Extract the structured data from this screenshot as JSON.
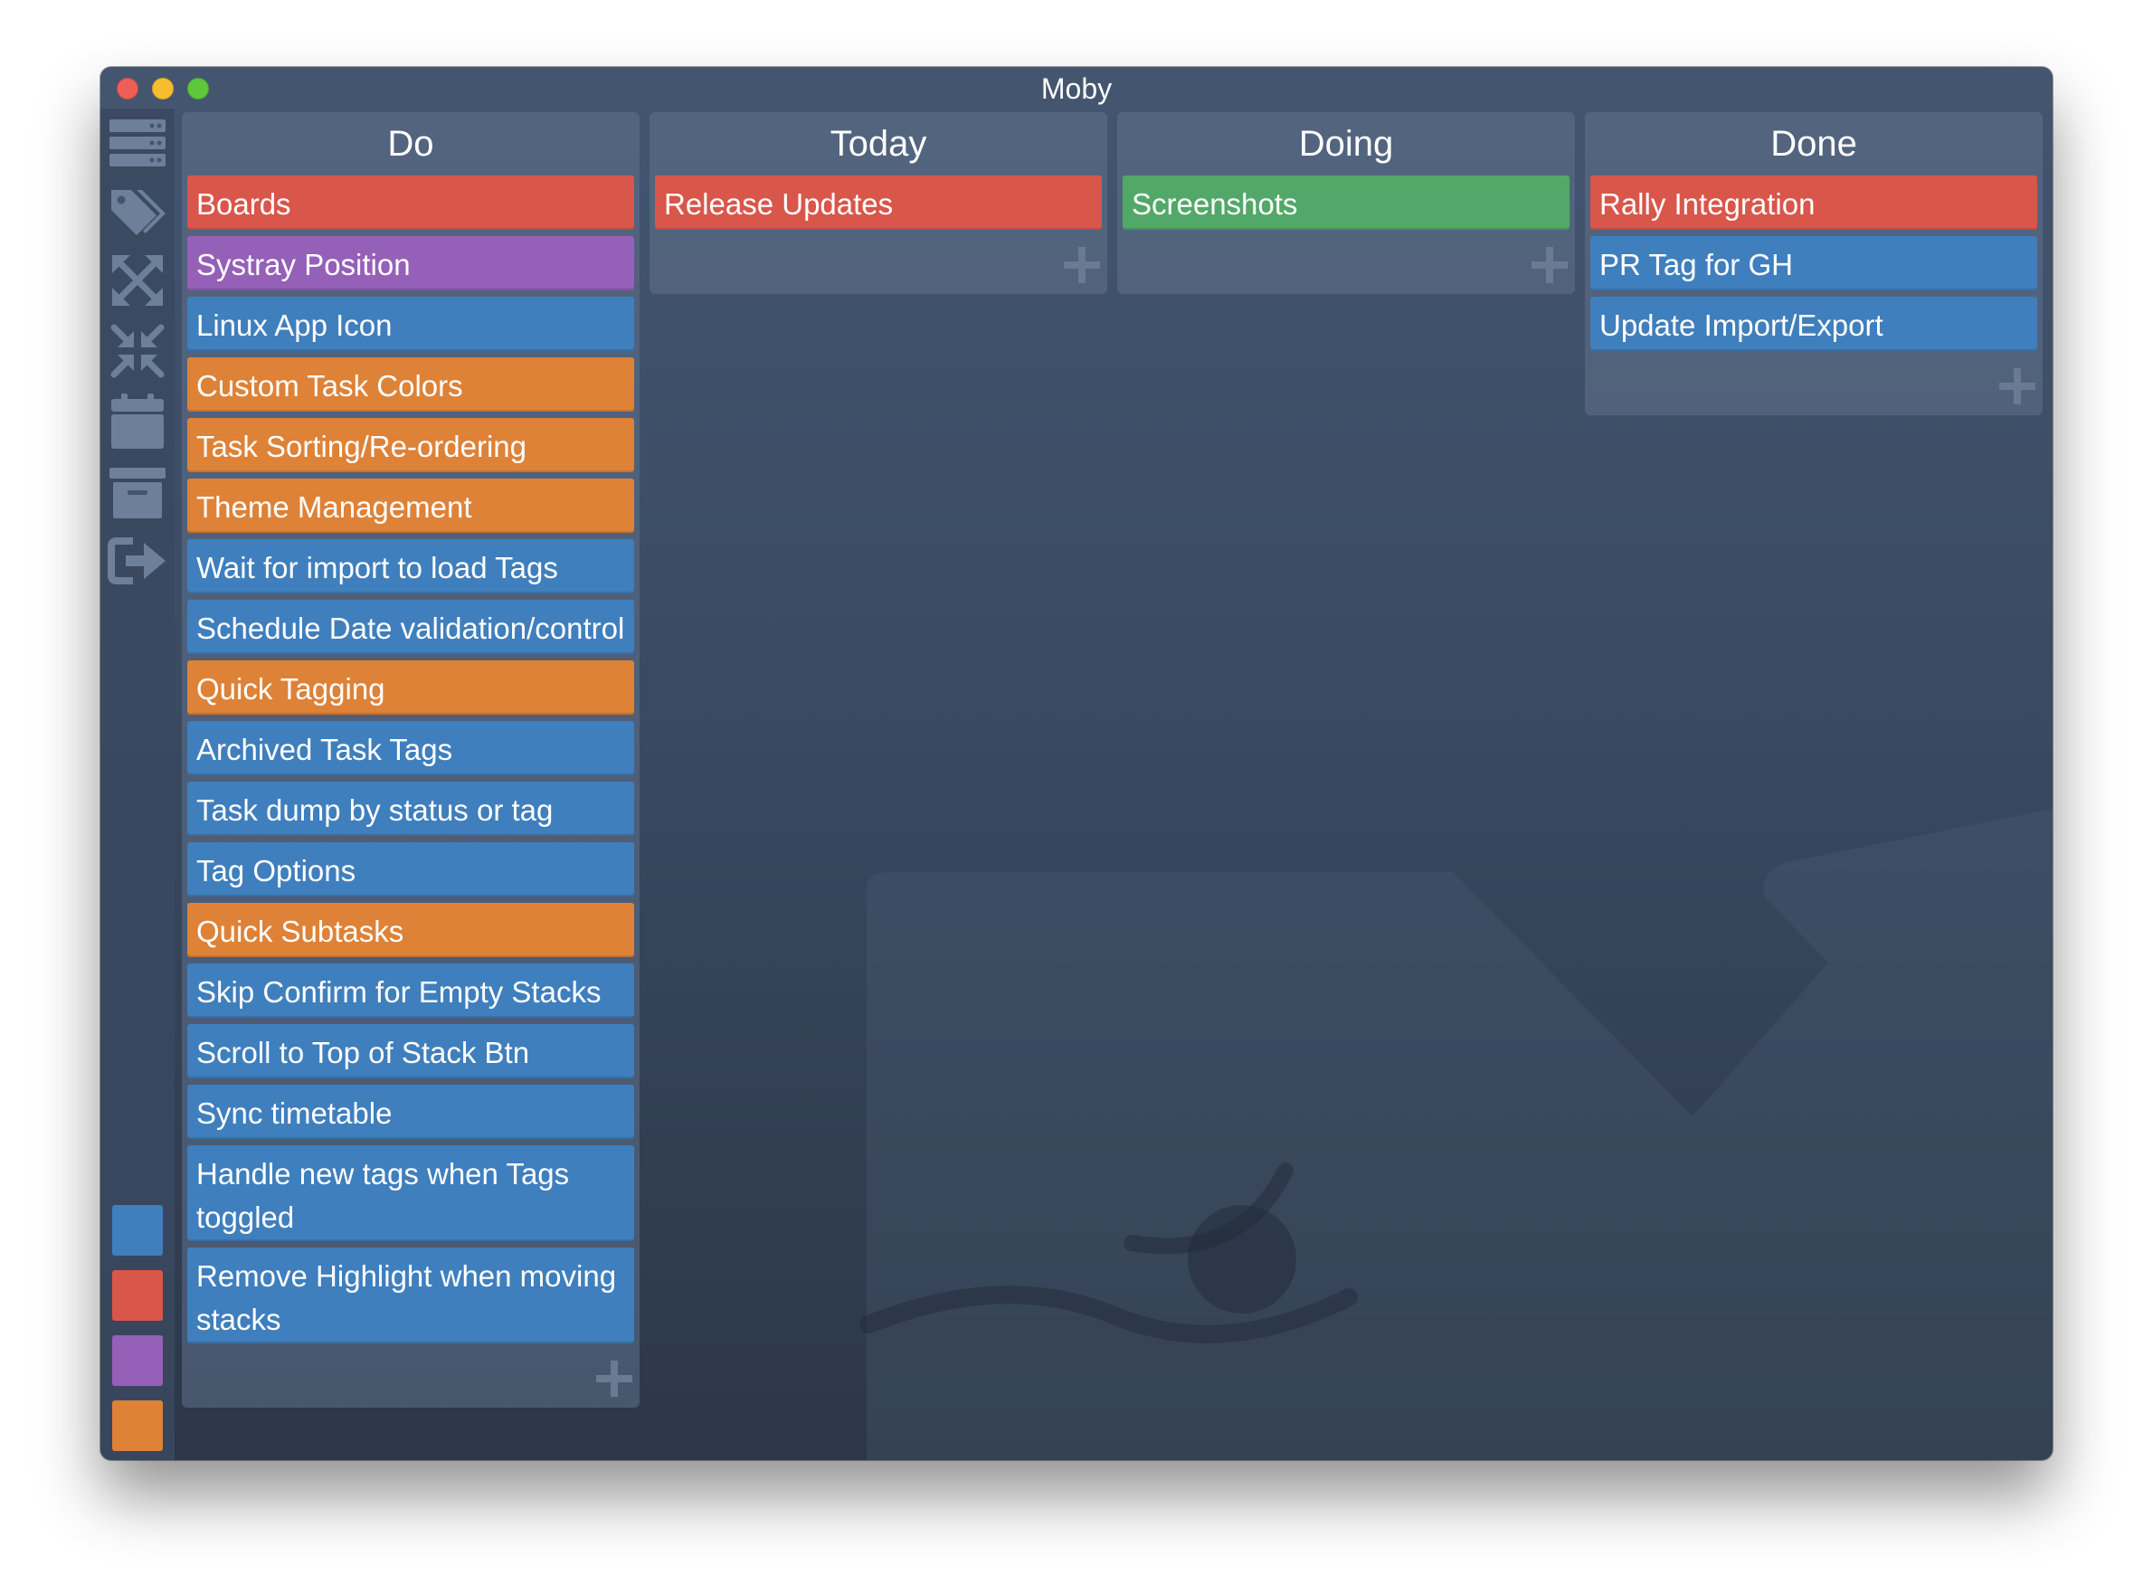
{
  "window": {
    "title": "Moby"
  },
  "colors": {
    "blue": "#3f7fbd",
    "red": "#d9564a",
    "purple": "#9560b7",
    "orange": "#de8238",
    "green": "#52a868"
  },
  "sidebar": {
    "icons": [
      "boards-icon",
      "tag-icon",
      "expand-icon",
      "collapse-icon",
      "calendar-icon",
      "archive-icon",
      "export-icon"
    ],
    "swatches": [
      "blue",
      "red",
      "purple",
      "orange",
      "green"
    ]
  },
  "stacks": [
    {
      "title": "Do",
      "cards": [
        {
          "label": "Boards",
          "color": "red"
        },
        {
          "label": "Systray Position",
          "color": "purple"
        },
        {
          "label": "Linux App Icon",
          "color": "blue"
        },
        {
          "label": "Custom Task Colors",
          "color": "orange"
        },
        {
          "label": "Task Sorting/Re-ordering",
          "color": "orange"
        },
        {
          "label": "Theme Management",
          "color": "orange"
        },
        {
          "label": "Wait for import to load Tags",
          "color": "blue"
        },
        {
          "label": "Schedule Date validation/control",
          "color": "blue"
        },
        {
          "label": "Quick Tagging",
          "color": "orange"
        },
        {
          "label": "Archived Task Tags",
          "color": "blue"
        },
        {
          "label": "Task dump by status or tag",
          "color": "blue"
        },
        {
          "label": "Tag Options",
          "color": "blue"
        },
        {
          "label": "Quick Subtasks",
          "color": "orange"
        },
        {
          "label": "Skip Confirm for Empty Stacks",
          "color": "blue"
        },
        {
          "label": "Scroll to Top of Stack Btn",
          "color": "blue"
        },
        {
          "label": "Sync timetable",
          "color": "blue"
        },
        {
          "label": "Handle new tags when Tags toggled",
          "color": "blue"
        },
        {
          "label": "Remove Highlight when moving stacks",
          "color": "blue"
        }
      ]
    },
    {
      "title": "Today",
      "cards": [
        {
          "label": "Release Updates",
          "color": "red"
        }
      ]
    },
    {
      "title": "Doing",
      "cards": [
        {
          "label": "Screenshots",
          "color": "green"
        }
      ]
    },
    {
      "title": "Done",
      "cards": [
        {
          "label": "Rally Integration",
          "color": "red"
        },
        {
          "label": "PR Tag for GH",
          "color": "blue"
        },
        {
          "label": "Update Import/Export",
          "color": "blue"
        }
      ]
    }
  ]
}
